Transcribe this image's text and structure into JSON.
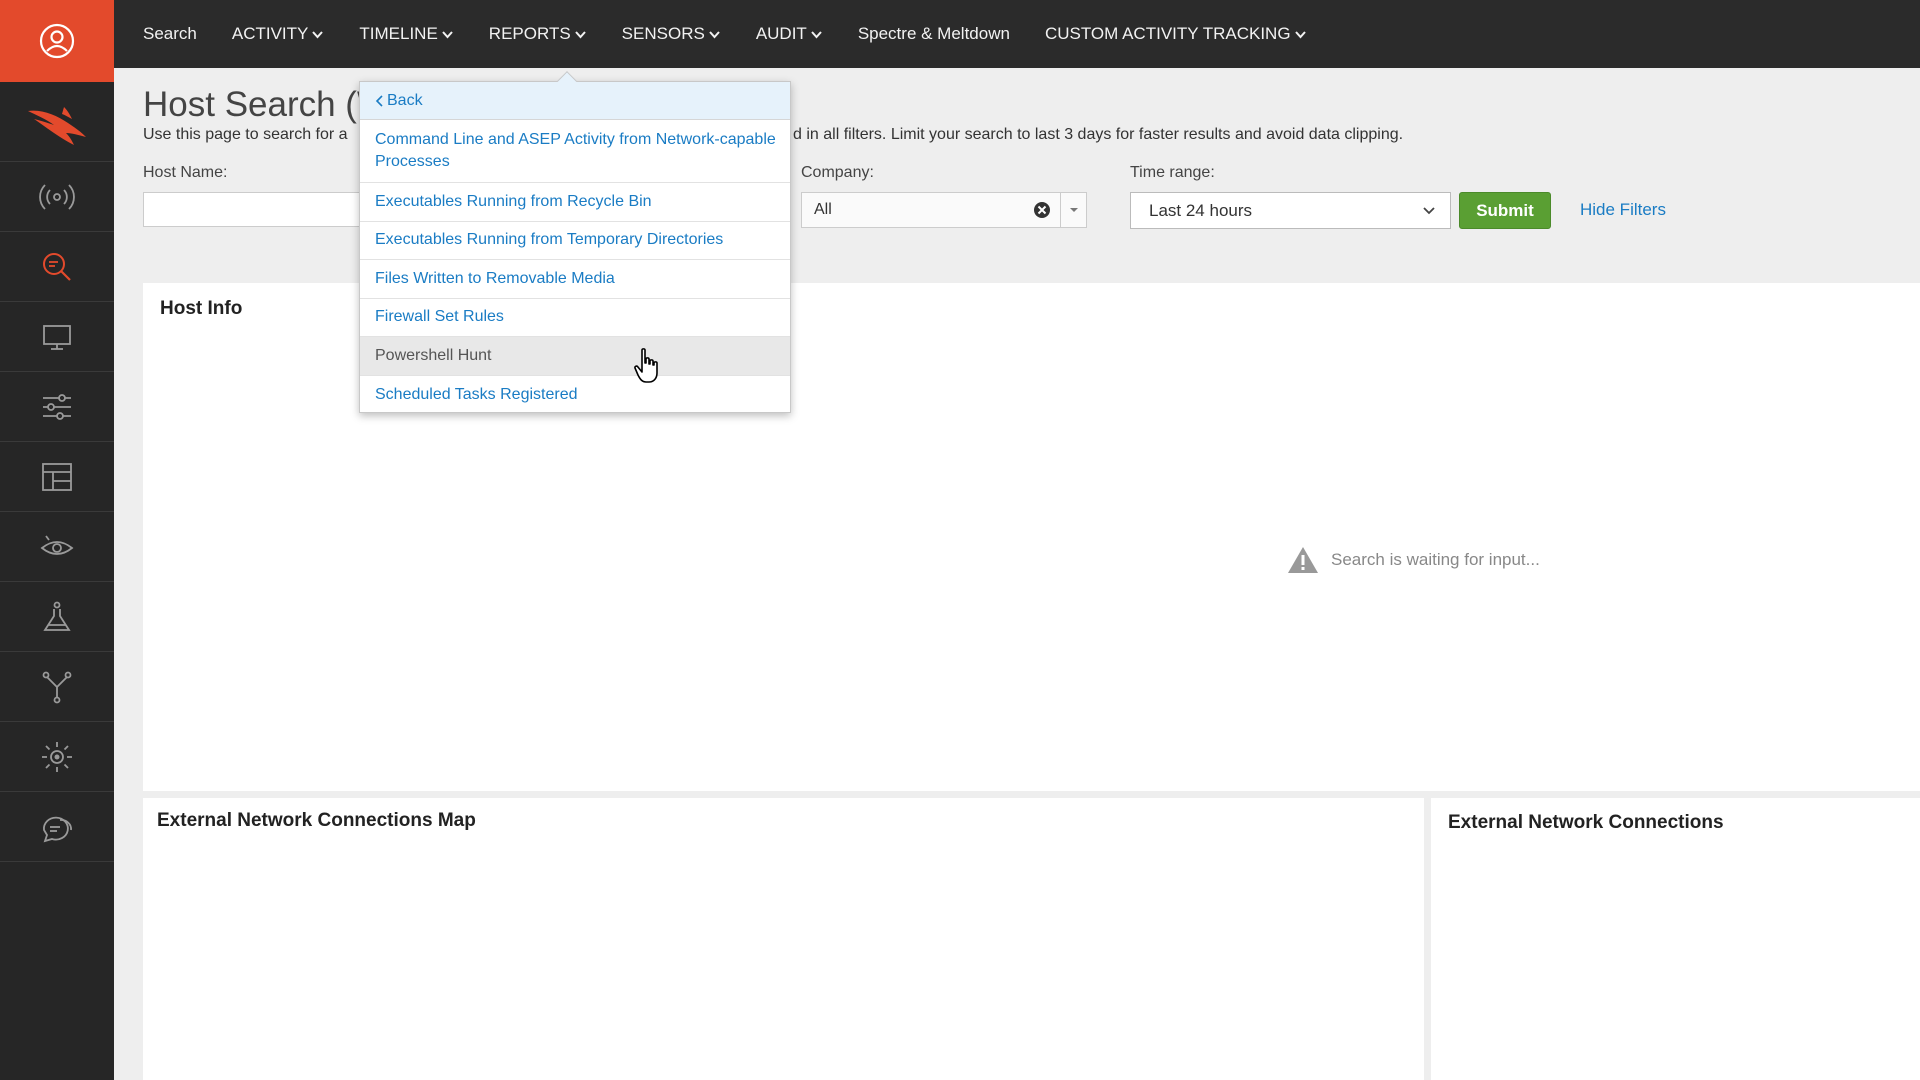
{
  "nav": {
    "items": [
      {
        "label": "Search",
        "caret": false
      },
      {
        "label": "ACTIVITY",
        "caret": true
      },
      {
        "label": "TIMELINE",
        "caret": true
      },
      {
        "label": "REPORTS",
        "caret": true
      },
      {
        "label": "SENSORS",
        "caret": true
      },
      {
        "label": "AUDIT",
        "caret": true
      },
      {
        "label": "Spectre & Meltdown",
        "caret": false
      },
      {
        "label": "CUSTOM ACTIVITY TRACKING",
        "caret": true
      }
    ]
  },
  "sidebar": {
    "user_icon": "user-circle-icon",
    "logo_icon": "falcon-logo-icon",
    "items": [
      {
        "icon": "broadcast-icon"
      },
      {
        "icon": "search-investigate-icon"
      },
      {
        "icon": "monitor-icon"
      },
      {
        "icon": "sliders-icon"
      },
      {
        "icon": "dashboard-icon"
      },
      {
        "icon": "eye-icon"
      },
      {
        "icon": "flask-icon"
      },
      {
        "icon": "network-fork-icon"
      },
      {
        "icon": "gear-sun-icon"
      },
      {
        "icon": "chat-bubbles-icon"
      }
    ]
  },
  "page": {
    "title": "Host Search (W",
    "desc_left": "Use this page to search for a",
    "desc_right": "d in all filters. Limit your search to last 3 days for faster results and avoid data clipping."
  },
  "filters": {
    "host_label": "Host Name:",
    "host_value": "",
    "company_label": "Company:",
    "company_value": "All",
    "time_label": "Time range:",
    "time_value": "Last 24 hours",
    "submit_label": "Submit",
    "hide_filters_label": "Hide Filters"
  },
  "panels": {
    "host_info_title": "Host Info",
    "waiting_text": "Search is waiting for input...",
    "ext_map_title": "External Network Connections Map",
    "ext_conn_title": "External Network Connections"
  },
  "dropdown": {
    "back_label": "Back",
    "items": [
      {
        "label": "Command Line and ASEP Activity from Network-capable Processes"
      },
      {
        "label": "Executables Running from Recycle Bin"
      },
      {
        "label": "Executables Running from Temporary Directories"
      },
      {
        "label": "Files Written to Removable Media"
      },
      {
        "label": "Firewall Set Rules"
      },
      {
        "label": "Powershell Hunt"
      },
      {
        "label": "Scheduled Tasks Registered"
      }
    ]
  },
  "colors": {
    "accent": "#e34a2c",
    "link": "#1a7cc4",
    "submit": "#5a9f33",
    "sidebar": "#262626",
    "topnav": "#2b2b2b"
  }
}
